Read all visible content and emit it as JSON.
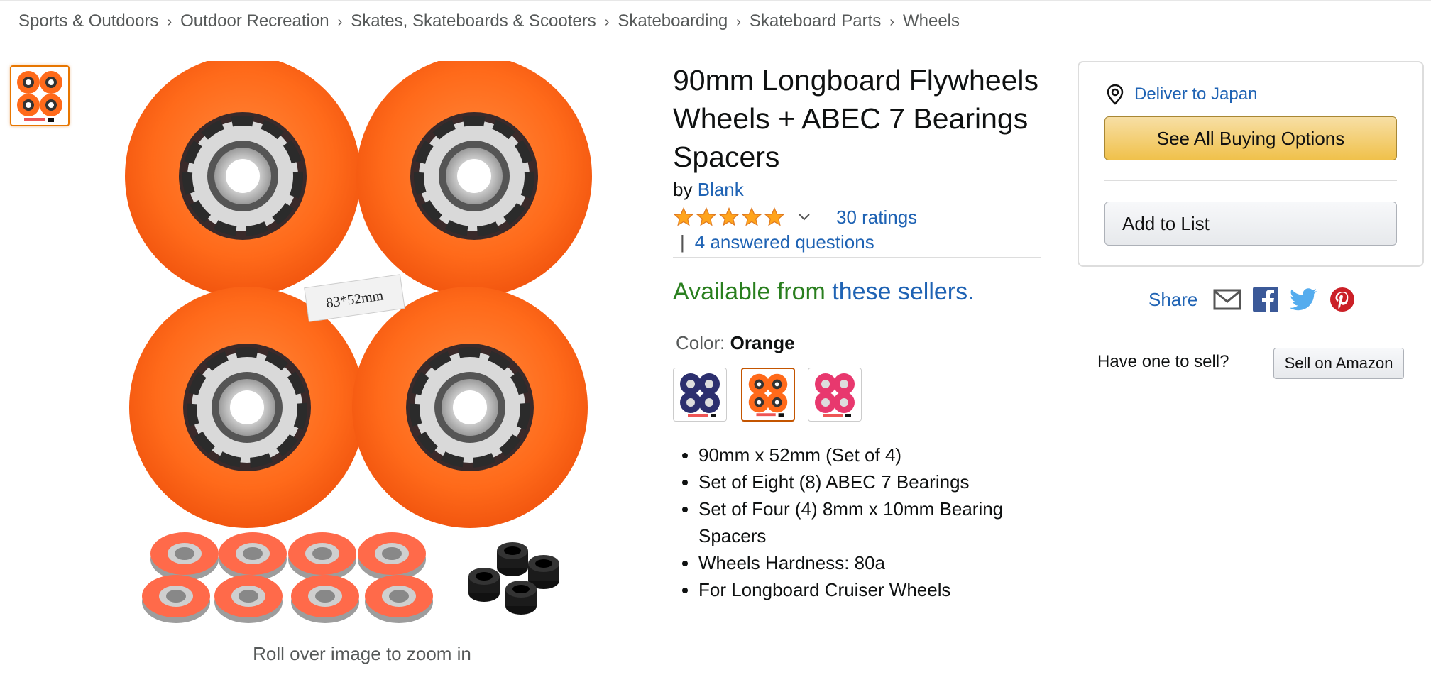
{
  "breadcrumb": [
    "Sports & Outdoors",
    "Outdoor Recreation",
    "Skates, Skateboards & Scooters",
    "Skateboarding",
    "Skateboard Parts",
    "Wheels"
  ],
  "breadcrumb_separator": "›",
  "image_caption": "Roll over image to zoom in",
  "image_label": "83*52mm",
  "product": {
    "title": "90mm Longboard Flywheels Wheels + ABEC 7 Bearings Spacers",
    "by_prefix": "by",
    "brand": "Blank",
    "rating_value": 5,
    "ratings_text": "30 ratings",
    "qa_separator": "|",
    "questions_text": "4 answered questions"
  },
  "availability": {
    "prefix": "Available from",
    "link": "these sellers",
    "suffix": "."
  },
  "color": {
    "label": "Color:",
    "selected": "Orange",
    "swatches": [
      {
        "name": "navy",
        "hex": "#2c2f6e"
      },
      {
        "name": "orange",
        "hex": "#ff6a1a"
      },
      {
        "name": "pink",
        "hex": "#e8386e"
      }
    ]
  },
  "features": [
    "90mm x 52mm (Set of 4)",
    "Set of Eight (8) ABEC 7 Bearings",
    "Set of Four (4) 8mm x 10mm Bearing Spacers",
    "Wheels Hardness: 80a",
    "For Longboard Cruiser Wheels"
  ],
  "buybox": {
    "deliver": "Deliver to Japan",
    "see_all": "See All Buying Options",
    "add_to_list": "Add to List"
  },
  "share": {
    "label": "Share"
  },
  "sell": {
    "question": "Have one to sell?",
    "button": "Sell on Amazon"
  },
  "colors": {
    "link": "#1f63b4",
    "available": "#2a7f1f",
    "wheel": "#ff6a1a",
    "star": "#ffa41c"
  }
}
